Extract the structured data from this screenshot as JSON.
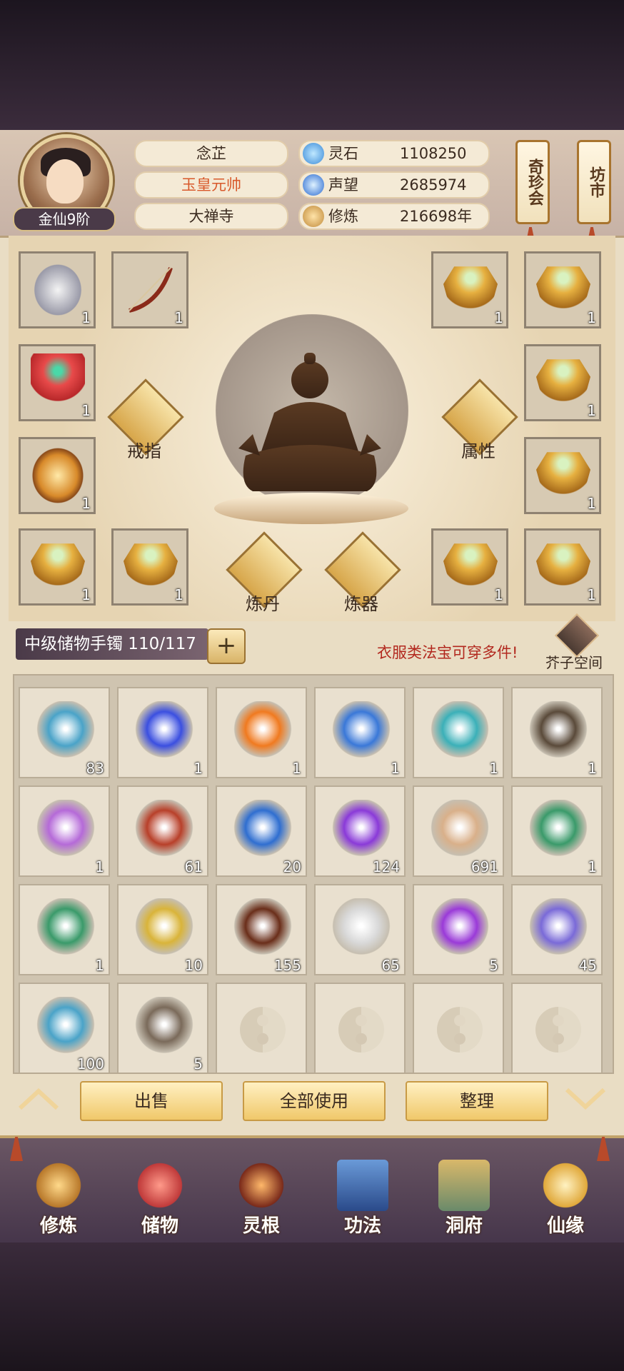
{
  "player": {
    "name": "念芷",
    "title": "玉皇元帅",
    "sect": "大禅寺",
    "rank": "金仙9阶"
  },
  "resources": [
    {
      "icon": "spirit-stone-icon",
      "label": "灵石",
      "value": "1108250"
    },
    {
      "icon": "prestige-icon",
      "label": "声望",
      "value": "2685974"
    },
    {
      "icon": "cultivation-icon",
      "label": "修炼",
      "value": "216698年"
    }
  ],
  "side_buttons": {
    "treasure_fair": "奇珍会",
    "market": "坊市"
  },
  "equipment": {
    "ring_label": "戒指",
    "attr_label": "属性",
    "alchemy_label": "炼丹",
    "forge_label": "炼器",
    "slots_left": [
      {
        "icon": "boots-icon",
        "count": "1"
      },
      {
        "icon": "bow-icon",
        "count": "1"
      },
      {
        "icon": "red-robe-icon",
        "count": "1"
      },
      {
        "icon": "golden-dragon-icon",
        "count": "1"
      },
      {
        "icon": "golden-armor-icon",
        "count": "1"
      },
      {
        "icon": "golden-armor-icon",
        "count": "1"
      }
    ],
    "slots_right": [
      {
        "icon": "golden-armor-icon",
        "count": "1"
      },
      {
        "icon": "golden-armor-icon",
        "count": "1"
      },
      {
        "icon": "golden-armor-icon",
        "count": "1"
      },
      {
        "icon": "golden-armor-icon",
        "count": "1"
      },
      {
        "icon": "golden-armor-icon",
        "count": "1"
      },
      {
        "icon": "golden-armor-icon",
        "count": "1"
      }
    ]
  },
  "storage": {
    "bag_label": "中级储物手镯 110/117",
    "hint": "衣服类法宝可穿多件!",
    "space_label": "芥子空间"
  },
  "inventory": [
    {
      "icon": "scroll-icon",
      "count": "83",
      "color": "#4aa3c8"
    },
    {
      "icon": "blue-flame-icon",
      "count": "1",
      "color": "#3b4fe0"
    },
    {
      "icon": "fire-icon",
      "count": "1",
      "color": "#f07a20"
    },
    {
      "icon": "water-drop-icon",
      "count": "1",
      "color": "#3a78d8"
    },
    {
      "icon": "water-drop-icon",
      "count": "1",
      "color": "#3bb0b8"
    },
    {
      "icon": "blossom-tree-icon",
      "count": "1",
      "color": "#5a4a3a"
    },
    {
      "icon": "powder-icon",
      "count": "1",
      "color": "#b56ad8"
    },
    {
      "icon": "teapot-icon",
      "count": "61",
      "color": "#b8402a"
    },
    {
      "icon": "berry-herb-icon",
      "count": "20",
      "color": "#2f6ed0"
    },
    {
      "icon": "purple-crystal-icon",
      "count": "124",
      "color": "#8a3ad8"
    },
    {
      "icon": "paper-scroll-icon",
      "count": "691",
      "color": "#d9b08a"
    },
    {
      "icon": "green-armor-icon",
      "count": "1",
      "color": "#3a9a6a"
    },
    {
      "icon": "green-armor-icon",
      "count": "1",
      "color": "#3a9a6a"
    },
    {
      "icon": "golden-herb-icon",
      "count": "10",
      "color": "#d9b43a"
    },
    {
      "icon": "wood-log-icon",
      "count": "155",
      "color": "#6a2e1a"
    },
    {
      "icon": "silver-ore-icon",
      "count": "65",
      "color": "#d9d9d9"
    },
    {
      "icon": "purple-flame-icon",
      "count": "5",
      "color": "#9a3ad8"
    },
    {
      "icon": "jade-pendant-icon",
      "count": "45",
      "color": "#7a6ad8"
    },
    {
      "icon": "scroll-icon",
      "count": "100",
      "color": "#4aa3c8"
    },
    {
      "icon": "ore-chunk-icon",
      "count": "5",
      "color": "#7a6a5a"
    },
    {
      "icon": "empty-slot",
      "count": "",
      "color": ""
    },
    {
      "icon": "empty-slot",
      "count": "",
      "color": ""
    },
    {
      "icon": "empty-slot",
      "count": "",
      "color": ""
    },
    {
      "icon": "empty-slot",
      "count": "",
      "color": ""
    }
  ],
  "actions": {
    "sell": "出售",
    "use_all": "全部使用",
    "sort": "整理"
  },
  "nav": [
    {
      "icon": "meditation-icon",
      "label": "修炼"
    },
    {
      "icon": "storage-bag-icon",
      "label": "储物"
    },
    {
      "icon": "spirit-root-icon",
      "label": "灵根"
    },
    {
      "icon": "technique-book-icon",
      "label": "功法"
    },
    {
      "icon": "cave-dwelling-icon",
      "label": "洞府"
    },
    {
      "icon": "fortune-gourd-icon",
      "label": "仙缘"
    }
  ]
}
